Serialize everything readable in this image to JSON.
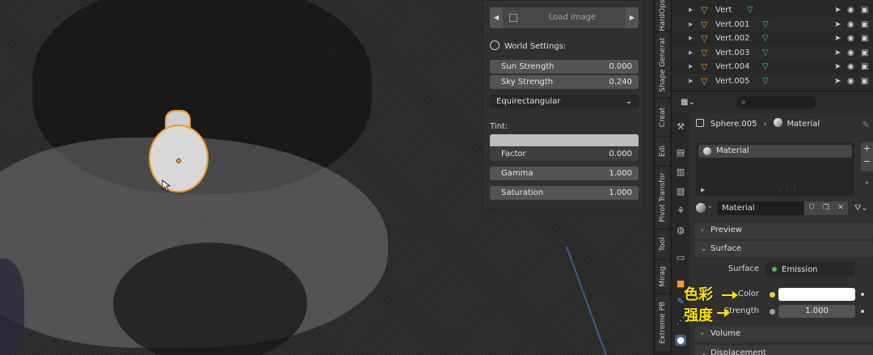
{
  "npanel": {
    "load_image": "Load image",
    "world_settings": "World Settings:",
    "sun_strength": {
      "label": "Sun Strength",
      "value": "0.000"
    },
    "sky_strength": {
      "label": "Sky Strength",
      "value": "0.240"
    },
    "projection": "Equirectangular",
    "tint_label": "Tint:",
    "factor": {
      "label": "Factor",
      "value": "0.000"
    },
    "gamma": {
      "label": "Gamma",
      "value": "1.000"
    },
    "saturation": {
      "label": "Saturation",
      "value": "1.000"
    }
  },
  "vtabs": [
    "HardOps",
    "Shape Generat",
    "Creat",
    "Edi",
    "Pivot Transfor",
    "Tool",
    "Mirag",
    "Extreme PB"
  ],
  "outliner": {
    "rows": [
      "Vert",
      "Vert.001",
      "Vert.002",
      "Vert.003",
      "Vert.004",
      "Vert.005"
    ]
  },
  "properties": {
    "object": "Sphere.005",
    "material_crumb": "Material",
    "slot_name": "Material",
    "material_name": "Material",
    "preview": "Preview",
    "surface_panel": "Surface",
    "surface_label": "Surface",
    "surface_value": "Emission",
    "color_label": "Color",
    "strength_label": "Strength",
    "strength_value": "1.000",
    "volume": "Volume",
    "displacement": "Displacement"
  },
  "annotations": {
    "color": "色彩",
    "strength": "强度"
  },
  "colors": {
    "selection_orange": "#f59b26",
    "mesh_green": "#3cc39a",
    "annotation_yellow": "#ffe400",
    "active_tab_blue": "#3f5f8f"
  }
}
